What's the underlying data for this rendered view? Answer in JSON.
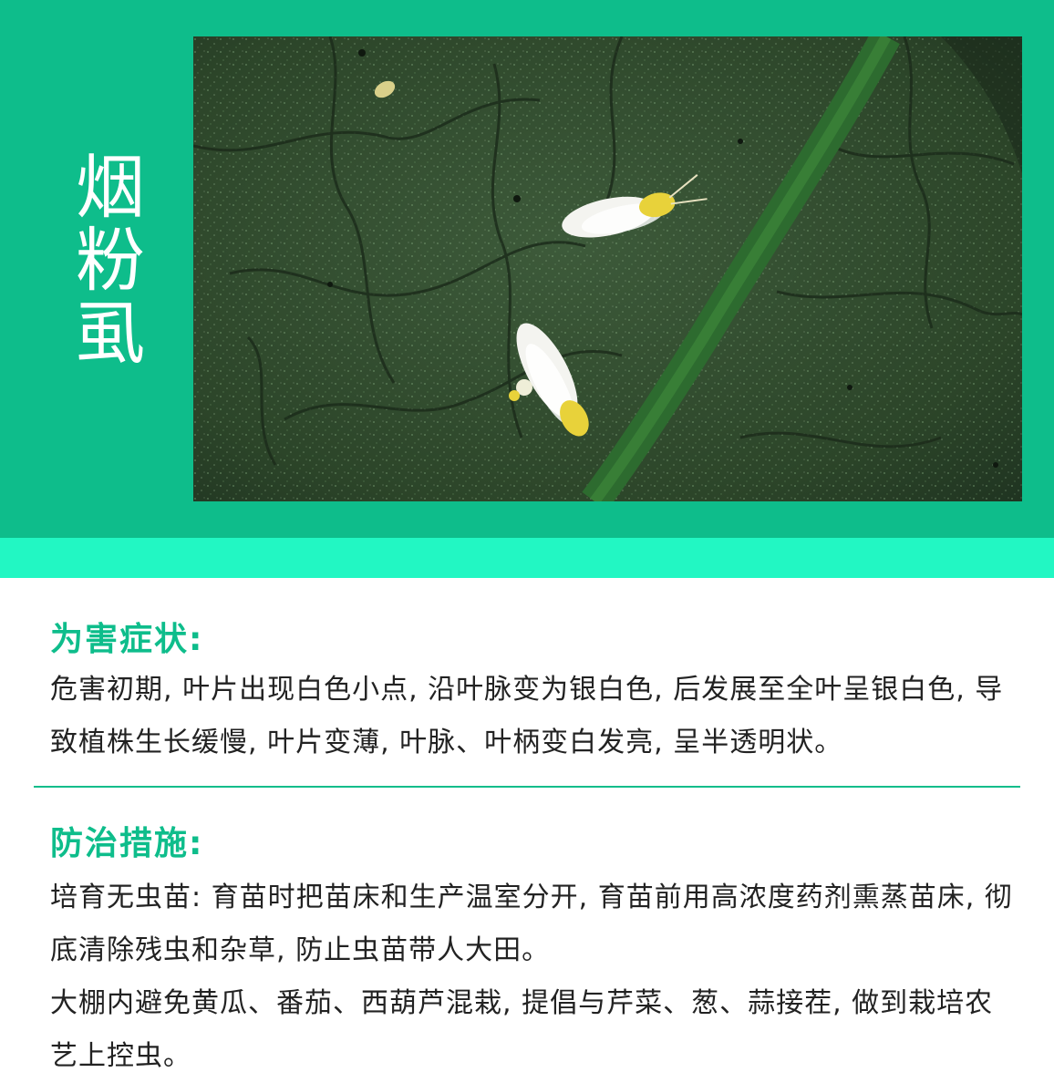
{
  "title": "烟粉虱",
  "photo": {
    "icon": "whitefly-on-leaf-photo",
    "colors": {
      "leaf": "#2f4a2e",
      "vein": "#2d6b2f",
      "insect": "#f4f4f0",
      "insect_body": "#e8d23a"
    }
  },
  "colors": {
    "accent": "#0ebd8b",
    "strip": "#22f7c3",
    "text": "#222222"
  },
  "symptoms": {
    "heading": "为害症状:",
    "text": "危害初期, 叶片出现白色小点, 沿叶脉变为银白色, 后发展至全叶呈银白色, 导致植株生长缓慢, 叶片变薄, 叶脉、叶柄变白发亮, 呈半透明状。"
  },
  "control": {
    "heading": "防治措施:",
    "paragraphs": [
      "培育无虫苗: 育苗时把苗床和生产温室分开, 育苗前用高浓度药剂熏蒸苗床, 彻底清除残虫和杂草, 防止虫苗带人大田。",
      "大棚内避免黄瓜、番茄、西葫芦混栽, 提倡与芹菜、葱、蒜接茬, 做到栽培农艺上控虫。"
    ]
  }
}
